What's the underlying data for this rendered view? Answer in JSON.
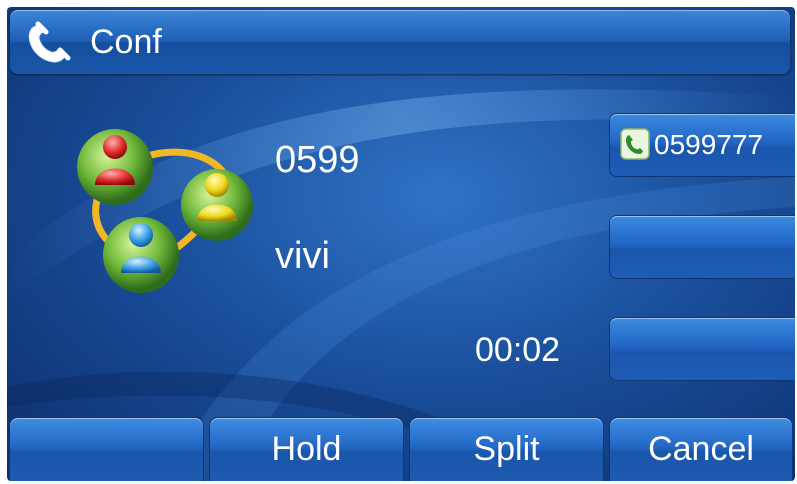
{
  "title": {
    "label": "Conf",
    "icon": "handset-icon"
  },
  "call": {
    "icon": "conference-icon",
    "number": "0599",
    "name": "vivi",
    "duration": "00:02"
  },
  "line_keys": [
    {
      "label": "0599777",
      "icon": "phone-line-icon"
    },
    {
      "label": ""
    },
    {
      "label": ""
    }
  ],
  "softkeys": [
    {
      "label": ""
    },
    {
      "label": "Hold"
    },
    {
      "label": "Split"
    },
    {
      "label": "Cancel"
    }
  ],
  "colors": {
    "background": "#1a4f9c",
    "button": "#2266c4",
    "text": "#ffffff"
  }
}
